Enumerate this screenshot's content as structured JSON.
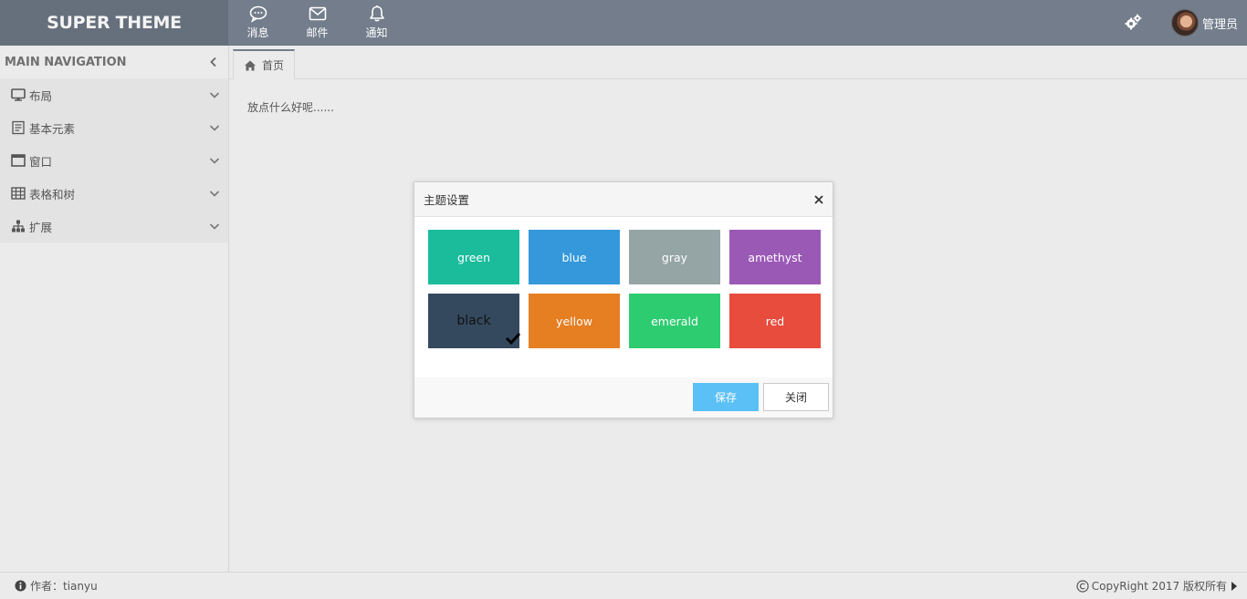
{
  "header": {
    "logo": "SUPER THEME",
    "nav": [
      {
        "label": "消息",
        "icon": "chat-icon"
      },
      {
        "label": "邮件",
        "icon": "envelope-icon"
      },
      {
        "label": "通知",
        "icon": "bell-icon"
      }
    ],
    "user_name": "管理员"
  },
  "sidebar": {
    "title": "MAIN NAVIGATION",
    "items": [
      {
        "label": "布局",
        "icon": "monitor-icon"
      },
      {
        "label": "基本元素",
        "icon": "form-icon"
      },
      {
        "label": "窗口",
        "icon": "window-icon"
      },
      {
        "label": "表格和树",
        "icon": "table-icon"
      },
      {
        "label": "扩展",
        "icon": "sitemap-icon"
      }
    ]
  },
  "tabs": [
    {
      "label": "首页",
      "icon": "home-icon",
      "active": true
    }
  ],
  "content": {
    "text": "放点什么好呢......"
  },
  "modal": {
    "title": "主题设置",
    "themes": [
      {
        "name": "green",
        "color": "#1abc9c"
      },
      {
        "name": "blue",
        "color": "#3498db"
      },
      {
        "name": "gray",
        "color": "#95a5a6"
      },
      {
        "name": "amethyst",
        "color": "#9b59b6"
      },
      {
        "name": "black",
        "color": "#34495e",
        "selected": true
      },
      {
        "name": "yellow",
        "color": "#e67e22"
      },
      {
        "name": "emerald",
        "color": "#2ecc71"
      },
      {
        "name": "red",
        "color": "#e74c3c"
      }
    ],
    "save_label": "保存",
    "close_label": "关闭"
  },
  "footer": {
    "author": "作者：tianyu",
    "copyright": "CopyRight 2017 版权所有"
  },
  "colors": {
    "header_bg": "#737d8b",
    "logo_bg": "#666f7c",
    "page_bg": "#ebebeb",
    "save_button": "#5bc0f5"
  }
}
